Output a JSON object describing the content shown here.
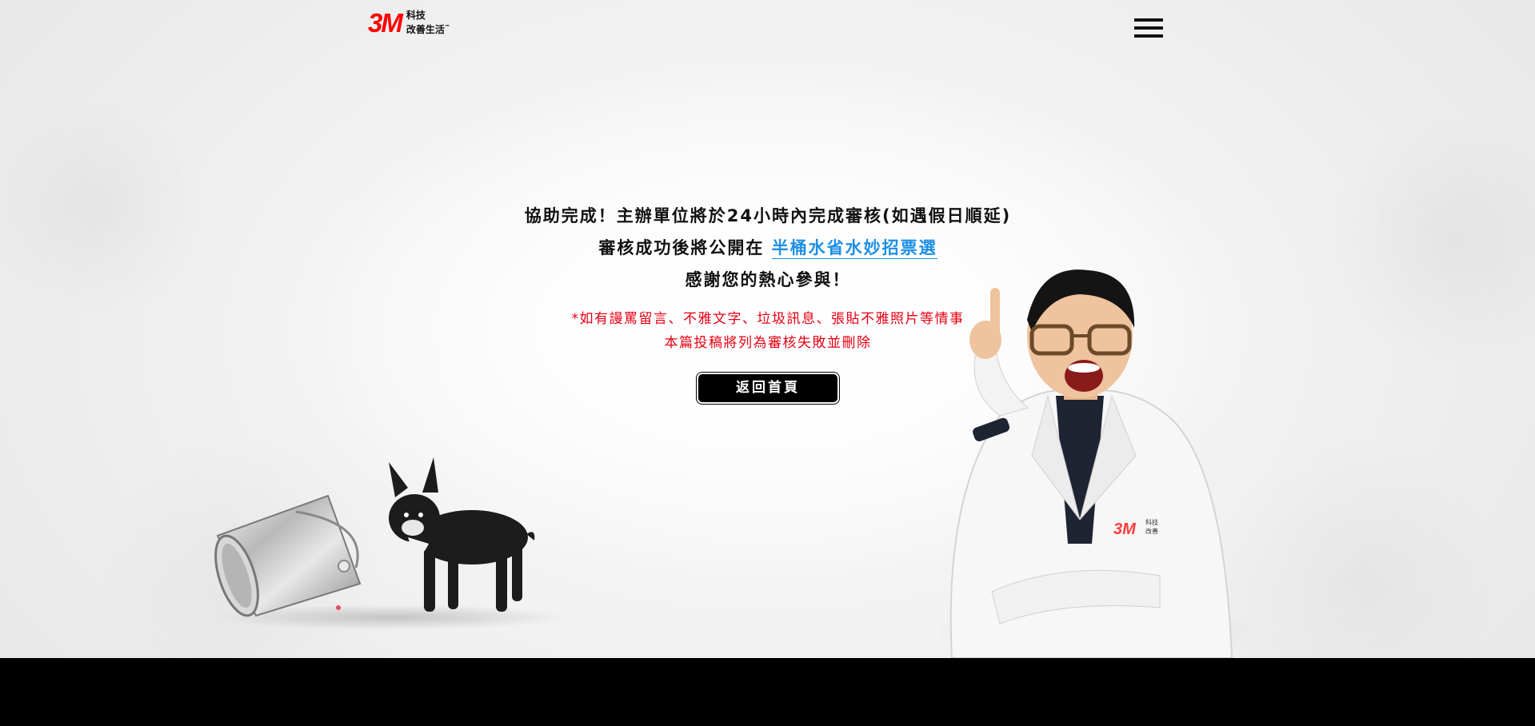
{
  "header": {
    "logo_mark": "3M",
    "logo_line1": "科技",
    "logo_line2": "改善生活",
    "logo_tm": "™",
    "menu_icon": "hamburger-menu-icon"
  },
  "message": {
    "line1": "協助完成！主辦單位將於24小時內完成審核(如遇假日順延)",
    "line2_prefix": "審核成功後將公開在 ",
    "line2_link": "半桶水省水妙招票選",
    "line3": "感謝您的熱心參與！",
    "warning_line1": "*如有謾罵留言、不雅文字、垃圾訊息、張貼不雅照片等情事",
    "warning_line2": "本篇投稿將列為審核失敗並刪除",
    "home_button": "返回首頁"
  },
  "illustrations": {
    "left": "bucket-and-dog",
    "right": "scientist-pointing-up",
    "coat_badge_mark": "3M",
    "coat_badge_line1": "科技",
    "coat_badge_line2": "改善"
  },
  "colors": {
    "brand_red": "#ff0000",
    "link_blue": "#1e90e6",
    "warning_red": "#e60012",
    "button_black": "#000000"
  }
}
